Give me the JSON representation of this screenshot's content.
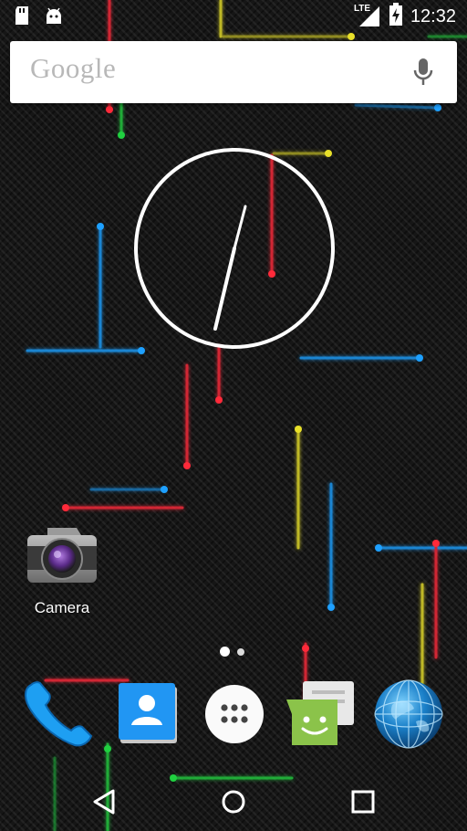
{
  "status_bar": {
    "time": "12:32",
    "network": "LTE",
    "icons": [
      "sd-card-icon",
      "android-icon",
      "lte-signal-icon",
      "battery-charging-icon"
    ]
  },
  "search_bar": {
    "hint": "Google",
    "mic_icon": "microphone-icon"
  },
  "desktop_apps": [
    {
      "label": "Camera",
      "icon": "camera-icon"
    }
  ],
  "page_indicator": {
    "pages": 2,
    "current": 1
  },
  "dock": [
    {
      "name": "Phone",
      "icon": "phone-icon"
    },
    {
      "name": "Contacts",
      "icon": "contacts-icon"
    },
    {
      "name": "All apps",
      "icon": "app-drawer-icon"
    },
    {
      "name": "Messenger",
      "icon": "messenger-icon"
    },
    {
      "name": "Browser",
      "icon": "browser-globe-icon"
    }
  ],
  "nav_bar": {
    "buttons": [
      "back-icon",
      "home-icon",
      "recents-icon"
    ]
  },
  "colors": {
    "wallpaper_base": "#161616",
    "neon_red": "#ff2a3a",
    "neon_blue": "#1ea0ff",
    "neon_yellow": "#e8e02a",
    "neon_green": "#20d040"
  }
}
